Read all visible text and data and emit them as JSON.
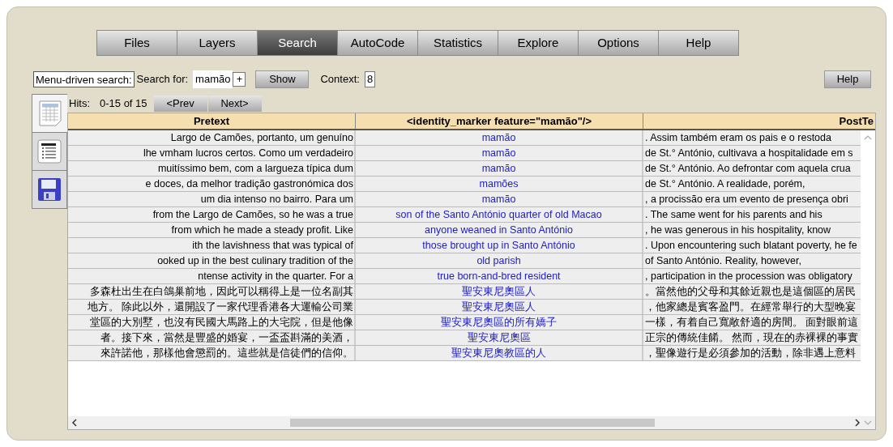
{
  "menu_tabs": [
    {
      "label": "Files",
      "selected": false
    },
    {
      "label": "Layers",
      "selected": false
    },
    {
      "label": "Search",
      "selected": true
    },
    {
      "label": "AutoCode",
      "selected": false
    },
    {
      "label": "Statistics",
      "selected": false
    },
    {
      "label": "Explore",
      "selected": false
    },
    {
      "label": "Options",
      "selected": false
    },
    {
      "label": "Help",
      "selected": false
    }
  ],
  "search_bar": {
    "mode_button": "Menu-driven search:",
    "search_label": "Search for:",
    "search_value": "mamão",
    "add_button": "+",
    "show_button": "Show",
    "context_label": "Context:",
    "context_value": "8",
    "help_button": "Help"
  },
  "side_tools": [
    {
      "kind": "table",
      "selected": true
    },
    {
      "kind": "summary",
      "selected": false
    },
    {
      "kind": "save",
      "selected": false
    }
  ],
  "hits": {
    "label": "Hits:",
    "range": "0-15 of 15",
    "prev_button": "<Prev",
    "next_button": "Next>"
  },
  "table": {
    "columns": [
      "Pretext",
      "<identity_marker feature=\"mamão\"/>",
      "PostTe"
    ],
    "rows": [
      {
        "pretext": "Largo de Camões, portanto, um genuíno",
        "match": "mamão",
        "posttext": ". Assim também eram os pais e o restoda"
      },
      {
        "pretext": "lhe vmham lucros certos. Como um verdadeiro",
        "match": "mamão",
        "posttext": "de St.° António, cultivava a hospitalidade em s"
      },
      {
        "pretext": "muitíssimo bem, com a largueza típica dum",
        "match": "mamão",
        "posttext": "de St.° António. Ao defrontar com aquela crua"
      },
      {
        "pretext": "e doces, da melhor tradição gastronómica dos",
        "match": "mamões",
        "posttext": "de St.° António. A realidade, porém,"
      },
      {
        "pretext": "um dia intenso no bairro. Para um",
        "match": "mamão",
        "posttext": ", a procissão era um evento de presença obri"
      },
      {
        "pretext": "from the Largo de Camões, so he was a true",
        "match": "son of the Santo António quarter of old Macao",
        "posttext": ". The same went for his parents and his"
      },
      {
        "pretext": "from which he made a steady profit. Like",
        "match": "anyone weaned in Santo António",
        "posttext": ", he was generous in his hospitality, know"
      },
      {
        "pretext": "ith the lavishness that was typical of",
        "match": "those brought up in Santo António",
        "posttext": ". Upon encountering such blatant poverty, he fe"
      },
      {
        "pretext": "ooked up in the best culinary tradition of the",
        "match": "old parish",
        "posttext": "of Santo António. Reality, however,"
      },
      {
        "pretext": "ntense activity in the quarter. For a",
        "match": "true born-and-bred resident",
        "posttext": ", participation in the procession was obligatory"
      },
      {
        "pretext": "多森杜出生在白鴿巢前地，因此可以稱得上是一位名副其",
        "match": "聖安東尼奧區人",
        "posttext": "。當然他的父母和其餘近親也是這個區的居民"
      },
      {
        "pretext": "地方。 除此以外，還開設了一家代理香港各大運輸公司業",
        "match": "聖安東尼奧區人",
        "posttext": "，他家總是賓客盈門。在經常舉行的大型晚宴"
      },
      {
        "pretext": "堂區的大別墅，也沒有民國大馬路上的大宅院，但是他像",
        "match": "聖安東尼奧區的所有嬌子",
        "posttext": "一樣，有着自己寬敞舒適的房間。 面對眼前這"
      },
      {
        "pretext": "者。接下來，當然是豐盛的婚宴，一盃盃斟滿的美酒，",
        "match": "聖安東尼奧區",
        "posttext": "正宗的傳統佳餚。 然而，現在的赤裸裸的事實"
      },
      {
        "pretext": "來許諾他，那樣他會懲罰的。這些就是信徒們的信仰。",
        "match": "聖安東尼奧教區的人",
        "posttext": "，聖像遊行是必須參加的活動，除非遇上意料"
      }
    ]
  }
}
